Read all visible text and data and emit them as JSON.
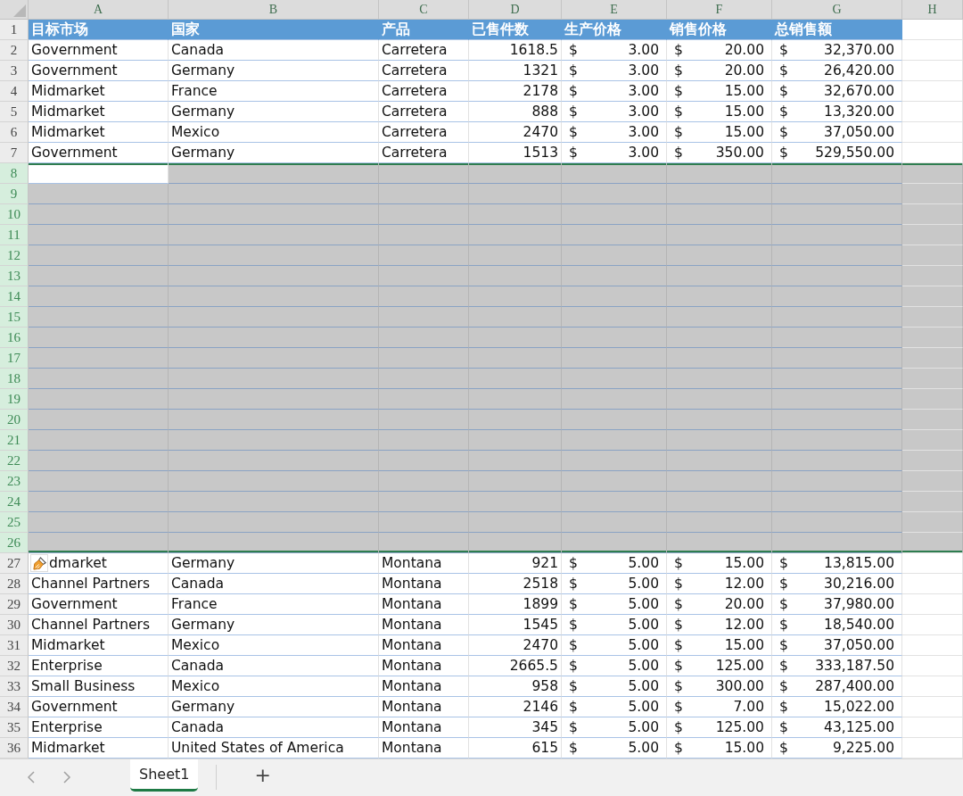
{
  "columns": [
    {
      "letter": "A",
      "kind": "text"
    },
    {
      "letter": "B",
      "kind": "text"
    },
    {
      "letter": "C",
      "kind": "text"
    },
    {
      "letter": "D",
      "kind": "number"
    },
    {
      "letter": "E",
      "kind": "currency"
    },
    {
      "letter": "F",
      "kind": "currency"
    },
    {
      "letter": "G",
      "kind": "currency"
    },
    {
      "letter": "H"
    }
  ],
  "rows": [
    {
      "number": "1",
      "kind": "header",
      "selected": false,
      "cells": [
        "目标市场",
        "国家",
        "产品",
        "已售件数",
        "生产价格",
        "销售价格",
        "总销售额"
      ]
    },
    {
      "number": "2",
      "kind": "data",
      "selected": false,
      "cells": [
        "Government",
        "Canada",
        "Carretera",
        "1618.5",
        [
          "$",
          "3.00"
        ],
        [
          "$",
          "20.00"
        ],
        [
          "$",
          "32,370.00"
        ]
      ]
    },
    {
      "number": "3",
      "kind": "data",
      "selected": false,
      "cells": [
        "Government",
        "Germany",
        "Carretera",
        "1321",
        [
          "$",
          "3.00"
        ],
        [
          "$",
          "20.00"
        ],
        [
          "$",
          "26,420.00"
        ]
      ]
    },
    {
      "number": "4",
      "kind": "data",
      "selected": false,
      "cells": [
        "Midmarket",
        "France",
        "Carretera",
        "2178",
        [
          "$",
          "3.00"
        ],
        [
          "$",
          "15.00"
        ],
        [
          "$",
          "32,670.00"
        ]
      ]
    },
    {
      "number": "5",
      "kind": "data",
      "selected": false,
      "cells": [
        "Midmarket",
        "Germany",
        "Carretera",
        "888",
        [
          "$",
          "3.00"
        ],
        [
          "$",
          "15.00"
        ],
        [
          "$",
          "13,320.00"
        ]
      ]
    },
    {
      "number": "6",
      "kind": "data",
      "selected": false,
      "cells": [
        "Midmarket",
        "Mexico",
        "Carretera",
        "2470",
        [
          "$",
          "3.00"
        ],
        [
          "$",
          "15.00"
        ],
        [
          "$",
          "37,050.00"
        ]
      ]
    },
    {
      "number": "7",
      "kind": "data",
      "selected": false,
      "cells": [
        "Government",
        "Germany",
        "Carretera",
        "1513",
        [
          "$",
          "3.00"
        ],
        [
          "$",
          "350.00"
        ],
        [
          "$",
          "529,550.00"
        ]
      ]
    },
    {
      "number": "8",
      "kind": "data",
      "selected": true,
      "active_cell": true
    },
    {
      "number": "9",
      "kind": "data",
      "selected": true
    },
    {
      "number": "10",
      "kind": "data",
      "selected": true
    },
    {
      "number": "11",
      "kind": "data",
      "selected": true
    },
    {
      "number": "12",
      "kind": "data",
      "selected": true
    },
    {
      "number": "13",
      "kind": "data",
      "selected": true
    },
    {
      "number": "14",
      "kind": "data",
      "selected": true
    },
    {
      "number": "15",
      "kind": "data",
      "selected": true
    },
    {
      "number": "16",
      "kind": "data",
      "selected": true
    },
    {
      "number": "17",
      "kind": "data",
      "selected": true
    },
    {
      "number": "18",
      "kind": "data",
      "selected": true
    },
    {
      "number": "19",
      "kind": "data",
      "selected": true
    },
    {
      "number": "20",
      "kind": "data",
      "selected": true
    },
    {
      "number": "21",
      "kind": "data",
      "selected": true
    },
    {
      "number": "22",
      "kind": "data",
      "selected": true
    },
    {
      "number": "23",
      "kind": "data",
      "selected": true
    },
    {
      "number": "24",
      "kind": "data",
      "selected": true
    },
    {
      "number": "25",
      "kind": "data",
      "selected": true
    },
    {
      "number": "26",
      "kind": "data",
      "selected": true
    },
    {
      "number": "27",
      "kind": "data",
      "selected": false,
      "paste_options": true,
      "cells": [
        "dmarket",
        "Germany",
        "Montana",
        "921",
        [
          "$",
          "5.00"
        ],
        [
          "$",
          "15.00"
        ],
        [
          "$",
          "13,815.00"
        ]
      ]
    },
    {
      "number": "28",
      "kind": "data",
      "selected": false,
      "cells": [
        "Channel Partners",
        "Canada",
        "Montana",
        "2518",
        [
          "$",
          "5.00"
        ],
        [
          "$",
          "12.00"
        ],
        [
          "$",
          "30,216.00"
        ]
      ]
    },
    {
      "number": "29",
      "kind": "data",
      "selected": false,
      "cells": [
        "Government",
        "France",
        "Montana",
        "1899",
        [
          "$",
          "5.00"
        ],
        [
          "$",
          "20.00"
        ],
        [
          "$",
          "37,980.00"
        ]
      ]
    },
    {
      "number": "30",
      "kind": "data",
      "selected": false,
      "cells": [
        "Channel Partners",
        "Germany",
        "Montana",
        "1545",
        [
          "$",
          "5.00"
        ],
        [
          "$",
          "12.00"
        ],
        [
          "$",
          "18,540.00"
        ]
      ]
    },
    {
      "number": "31",
      "kind": "data",
      "selected": false,
      "cells": [
        "Midmarket",
        "Mexico",
        "Montana",
        "2470",
        [
          "$",
          "5.00"
        ],
        [
          "$",
          "15.00"
        ],
        [
          "$",
          "37,050.00"
        ]
      ]
    },
    {
      "number": "32",
      "kind": "data",
      "selected": false,
      "cells": [
        "Enterprise",
        "Canada",
        "Montana",
        "2665.5",
        [
          "$",
          "5.00"
        ],
        [
          "$",
          "125.00"
        ],
        [
          "$",
          "333,187.50"
        ]
      ]
    },
    {
      "number": "33",
      "kind": "data",
      "selected": false,
      "cells": [
        "Small Business",
        "Mexico",
        "Montana",
        "958",
        [
          "$",
          "5.00"
        ],
        [
          "$",
          "300.00"
        ],
        [
          "$",
          "287,400.00"
        ]
      ]
    },
    {
      "number": "34",
      "kind": "data",
      "selected": false,
      "cells": [
        "Government",
        "Germany",
        "Montana",
        "2146",
        [
          "$",
          "5.00"
        ],
        [
          "$",
          "7.00"
        ],
        [
          "$",
          "15,022.00"
        ]
      ]
    },
    {
      "number": "35",
      "kind": "data",
      "selected": false,
      "cells": [
        "Enterprise",
        "Canada",
        "Montana",
        "345",
        [
          "$",
          "5.00"
        ],
        [
          "$",
          "125.00"
        ],
        [
          "$",
          "43,125.00"
        ]
      ]
    },
    {
      "number": "36",
      "kind": "data",
      "selected": false,
      "cells": [
        "Midmarket",
        "United States of America",
        "Montana",
        "615",
        [
          "$",
          "5.00"
        ],
        [
          "$",
          "15.00"
        ],
        [
          "$",
          "9,225.00"
        ]
      ]
    }
  ],
  "sheet_tabs": [
    {
      "label": "Sheet1",
      "selected": true
    }
  ],
  "add_sheet": "+"
}
